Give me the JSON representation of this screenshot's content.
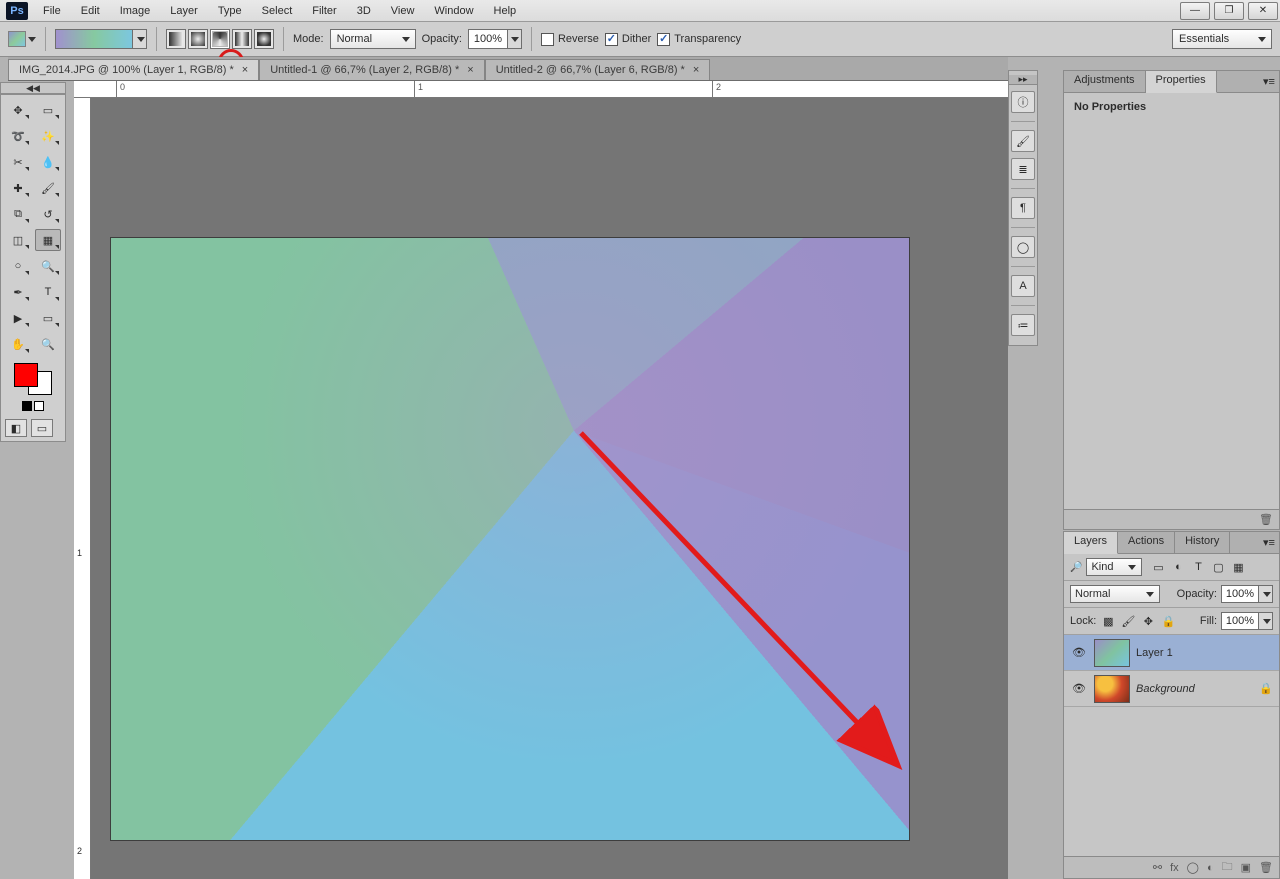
{
  "app": {
    "badge": "Ps"
  },
  "menu": [
    "File",
    "Edit",
    "Image",
    "Layer",
    "Type",
    "Select",
    "Filter",
    "3D",
    "View",
    "Window",
    "Help"
  ],
  "options": {
    "mode_label": "Mode:",
    "mode_value": "Normal",
    "opacity_label": "Opacity:",
    "opacity_value": "100%",
    "reverse": "Reverse",
    "dither": "Dither",
    "transparency": "Transparency",
    "workspace": "Essentials"
  },
  "tabs": [
    {
      "label": "IMG_2014.JPG @ 100% (Layer 1, RGB/8) *",
      "active": true
    },
    {
      "label": "Untitled-1 @ 66,7% (Layer 2, RGB/8) *",
      "active": false
    },
    {
      "label": "Untitled-2 @ 66,7% (Layer 6, RGB/8) *",
      "active": false
    }
  ],
  "ruler": {
    "h0": "0",
    "h1": "1",
    "h2": "2",
    "v1": "1",
    "v2": "2"
  },
  "swatch_fg": "#ff0000",
  "collapse_glyph": "◀◀",
  "panelA": {
    "tab1": "Adjustments",
    "tab2": "Properties",
    "body": "No Properties"
  },
  "panelB": {
    "tab1": "Layers",
    "tab2": "Actions",
    "tab3": "History",
    "kind_label": "Kind",
    "blend": "Normal",
    "opacity_label": "Opacity:",
    "opacity_value": "100%",
    "lock_label": "Lock:",
    "fill_label": "Fill:",
    "fill_value": "100%",
    "layers": [
      {
        "name": "Layer 1",
        "selected": true,
        "italic": false,
        "locked": false,
        "thumb": "grad"
      },
      {
        "name": "Background",
        "selected": false,
        "italic": true,
        "locked": true,
        "thumb": "bgimg"
      }
    ]
  }
}
